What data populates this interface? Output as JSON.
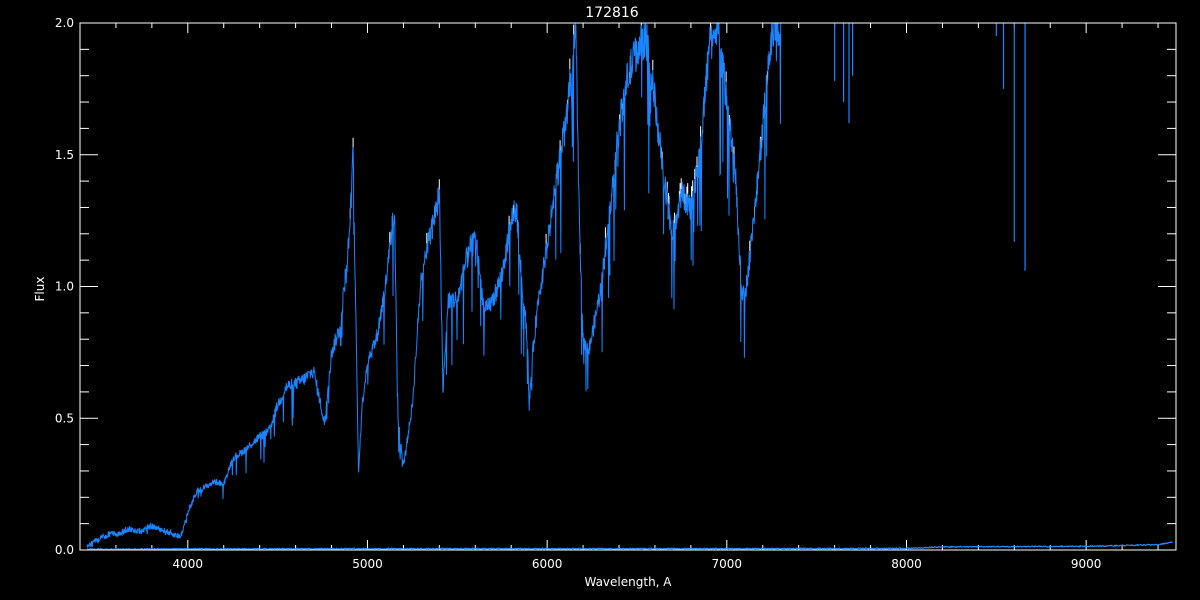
{
  "chart_data": {
    "type": "line",
    "title": "172816",
    "xlabel": "Wavelength, A",
    "ylabel": "Flux",
    "xlim": [
      3400,
      9500
    ],
    "ylim": [
      0,
      2
    ],
    "grid": false,
    "legend": "none",
    "x_ticks": [
      4000,
      5000,
      6000,
      7000,
      8000,
      9000
    ],
    "x_tick_labels": [
      "4000",
      "5000",
      "6000",
      "7000",
      "8000",
      "9000"
    ],
    "y_ticks": [
      0,
      0.5,
      1,
      1.5,
      2
    ],
    "y_tick_labels": [
      "0.0",
      "0.5",
      "1.0",
      "1.5",
      "2.0"
    ],
    "colors": {
      "background": "#000000",
      "axes": "#ffffff",
      "flux": "#1a85ff",
      "error": "#2e8bff",
      "spikes": "#ffffff"
    },
    "series": [
      {
        "x": [
          3440,
          3480,
          3520,
          3560,
          3600,
          3640,
          3680,
          3720,
          3760,
          3800,
          3840,
          3880,
          3920,
          3960,
          4000,
          4050,
          4100,
          4150,
          4200,
          4250,
          4300,
          4350,
          4400,
          4450,
          4500,
          4550,
          4600,
          4650,
          4700,
          4740,
          4760,
          4800,
          4850,
          4900,
          4920,
          4950,
          4970,
          5000,
          5050,
          5100,
          5150,
          5170,
          5200,
          5250,
          5300,
          5350,
          5400,
          5420,
          5450,
          5500,
          5550,
          5600,
          5650,
          5700,
          5750,
          5800,
          5830,
          5860,
          5890,
          5900,
          5920,
          5950,
          6000,
          6050,
          6100,
          6150,
          6160,
          6180,
          6200,
          6230,
          6260,
          6300,
          6350,
          6400,
          6450,
          6500,
          6550,
          6600,
          6650,
          6700,
          6750,
          6800,
          6850,
          6900,
          6950,
          7000,
          7050,
          7080,
          7100,
          7150,
          7200,
          7250,
          7300
        ],
        "values": [
          0.01,
          0.03,
          0.05,
          0.06,
          0.06,
          0.07,
          0.08,
          0.07,
          0.08,
          0.09,
          0.08,
          0.07,
          0.06,
          0.05,
          0.14,
          0.22,
          0.24,
          0.26,
          0.25,
          0.35,
          0.37,
          0.4,
          0.43,
          0.45,
          0.55,
          0.62,
          0.63,
          0.65,
          0.68,
          0.55,
          0.48,
          0.75,
          0.85,
          1.2,
          1.5,
          0.3,
          0.55,
          0.72,
          0.8,
          1.0,
          1.3,
          0.5,
          0.32,
          0.55,
          1.05,
          1.2,
          1.35,
          0.6,
          0.95,
          0.95,
          1.1,
          1.2,
          0.9,
          0.95,
          1.05,
          1.25,
          1.3,
          1.0,
          0.8,
          0.55,
          0.75,
          0.95,
          1.15,
          1.4,
          1.6,
          1.9,
          2.0,
          1.2,
          0.8,
          0.75,
          0.85,
          1.0,
          1.3,
          1.6,
          1.8,
          1.9,
          1.95,
          1.7,
          1.4,
          1.2,
          1.35,
          1.3,
          1.5,
          1.9,
          2.0,
          1.7,
          1.4,
          1.0,
          0.95,
          1.25,
          1.6,
          1.95,
          2.0
        ]
      },
      {
        "x": [
          3440,
          4000,
          5000,
          6000,
          7000,
          8000,
          8200,
          9000,
          9400,
          9480
        ],
        "values": [
          0.003,
          0.004,
          0.005,
          0.005,
          0.005,
          0.006,
          0.012,
          0.014,
          0.02,
          0.03
        ]
      }
    ]
  }
}
